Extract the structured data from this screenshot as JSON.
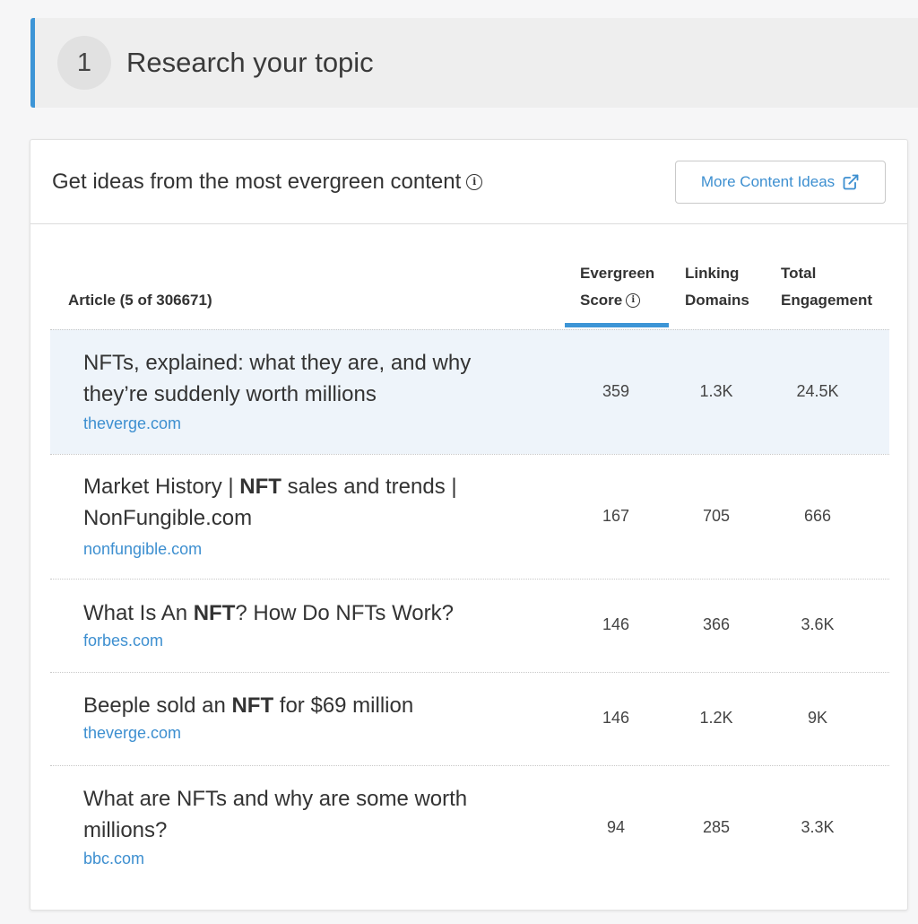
{
  "step": {
    "number": "1",
    "title": "Research your topic"
  },
  "card": {
    "title": "Get ideas from the most evergreen content",
    "more_button": "More Content Ideas"
  },
  "table": {
    "headers": {
      "article": "Article (5 of 306671)",
      "score_line1": "Evergreen",
      "score_line2": "Score",
      "linking_line1": "Linking",
      "linking_line2": "Domains",
      "engagement_line1": "Total",
      "engagement_line2": "Engagement"
    },
    "rows": [
      {
        "title_pre": "NFTs, explained: what they are, and why they’re suddenly worth millions",
        "title_bold": "",
        "title_post": "",
        "domain": "theverge.com",
        "score": "359",
        "linking": "1.3K",
        "engagement": "24.5K"
      },
      {
        "title_pre": "Market History | ",
        "title_bold": "NFT",
        "title_post": " sales and trends | NonFungible.com",
        "domain": "nonfungible.com",
        "score": "167",
        "linking": "705",
        "engagement": "666"
      },
      {
        "title_pre": "What Is An ",
        "title_bold": "NFT",
        "title_post": "? How Do NFTs Work?",
        "domain": "forbes.com",
        "score": "146",
        "linking": "366",
        "engagement": "3.6K"
      },
      {
        "title_pre": "Beeple sold an ",
        "title_bold": "NFT",
        "title_post": " for $69 million",
        "domain": "theverge.com",
        "score": "146",
        "linking": "1.2K",
        "engagement": "9K"
      },
      {
        "title_pre": "What are NFTs and why are some worth millions?",
        "title_bold": "",
        "title_post": "",
        "domain": "bbc.com",
        "score": "94",
        "linking": "285",
        "engagement": "3.3K"
      }
    ]
  },
  "colors": {
    "accent": "#3d95d6",
    "link": "#3d8fd0",
    "highlight_row": "#eef4fa"
  }
}
